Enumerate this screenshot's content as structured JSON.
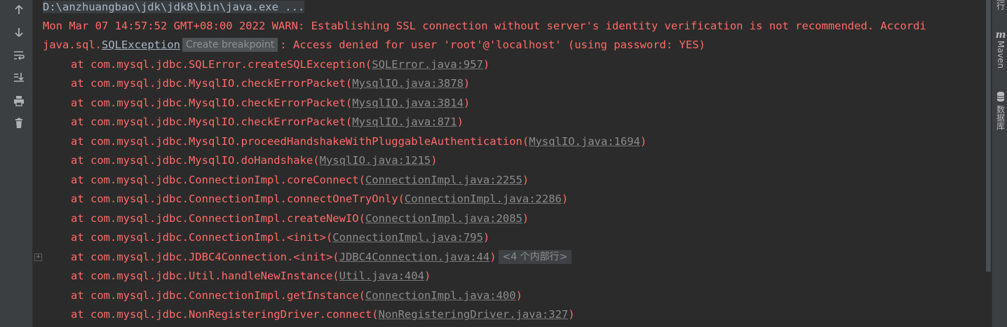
{
  "console": {
    "command": "D:\\anzhuangbao\\jdk\\jdk8\\bin\\java.exe ...",
    "warn": "Mon Mar 07 14:57:52 GMT+08:00 2022 WARN: Establishing SSL connection without server's identity verification is not recommended. Accordi",
    "exception": {
      "prefix": "java.sql.",
      "class_link": "SQLException",
      "tooltip": "Create breakpoint",
      "message": ": Access denied for user 'root'@'localhost' (using password: YES)"
    },
    "trace": [
      {
        "method": "at com.mysql.jdbc.SQLError.createSQLException(",
        "link": "SQLError.java:957",
        "close": ")"
      },
      {
        "method": "at com.mysql.jdbc.MysqlIO.checkErrorPacket(",
        "link": "MysqlIO.java:3878",
        "close": ")"
      },
      {
        "method": "at com.mysql.jdbc.MysqlIO.checkErrorPacket(",
        "link": "MysqlIO.java:3814",
        "close": ")"
      },
      {
        "method": "at com.mysql.jdbc.MysqlIO.checkErrorPacket(",
        "link": "MysqlIO.java:871",
        "close": ")"
      },
      {
        "method": "at com.mysql.jdbc.MysqlIO.proceedHandshakeWithPluggableAuthentication(",
        "link": "MysqlIO.java:1694",
        "close": ")"
      },
      {
        "method": "at com.mysql.jdbc.MysqlIO.doHandshake(",
        "link": "MysqlIO.java:1215",
        "close": ")"
      },
      {
        "method": "at com.mysql.jdbc.ConnectionImpl.coreConnect(",
        "link": "ConnectionImpl.java:2255",
        "close": ")"
      },
      {
        "method": "at com.mysql.jdbc.ConnectionImpl.connectOneTryOnly(",
        "link": "ConnectionImpl.java:2286",
        "close": ")"
      },
      {
        "method": "at com.mysql.jdbc.ConnectionImpl.createNewIO(",
        "link": "ConnectionImpl.java:2085",
        "close": ")"
      },
      {
        "method": "at com.mysql.jdbc.ConnectionImpl.<init>(",
        "link": "ConnectionImpl.java:795",
        "close": ")"
      },
      {
        "method": "at com.mysql.jdbc.JDBC4Connection.<init>(",
        "link": "JDBC4Connection.java:44",
        "close": ")",
        "folded": "<4 个内部行>"
      },
      {
        "method": "at com.mysql.jdbc.Util.handleNewInstance(",
        "link": "Util.java:404",
        "close": ")"
      },
      {
        "method": "at com.mysql.jdbc.ConnectionImpl.getInstance(",
        "link": "ConnectionImpl.java:400",
        "close": ")"
      },
      {
        "method": "at com.mysql.jdbc.NonRegisteringDriver.connect(",
        "link": "NonRegisteringDriver.java:327",
        "close": ")"
      }
    ]
  },
  "toolbar": {
    "icons": [
      "arrow-up-icon",
      "arrow-down-icon",
      "soft-wrap-icon",
      "scroll-to-end-icon",
      "print-icon",
      "trash-icon"
    ]
  },
  "right_panel": {
    "top_label": "运行",
    "maven_label": "Maven",
    "database_label": "数据库"
  },
  "colors": {
    "background": "#2b2b2b",
    "error_text": "#ff6b68",
    "link_text": "#8c8c8c",
    "toolbar": "#3c3f41"
  }
}
